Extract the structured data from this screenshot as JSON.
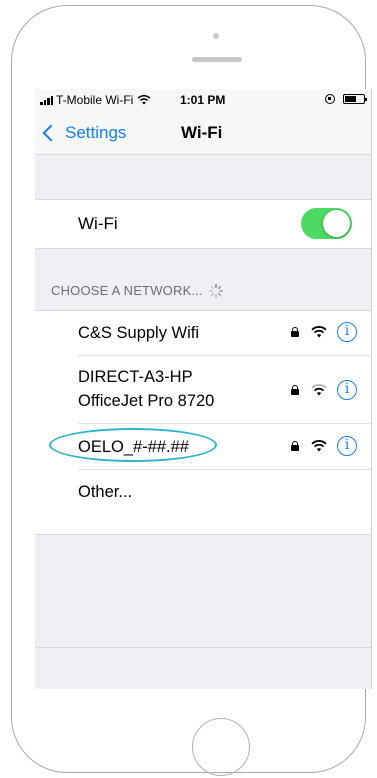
{
  "status_bar": {
    "carrier": "T-Mobile Wi-Fi",
    "time": "1:01 PM"
  },
  "nav": {
    "back_label": "Settings",
    "title": "Wi-Fi"
  },
  "wifi_toggle": {
    "label": "Wi-Fi",
    "on": true
  },
  "section_header": "CHOOSE A NETWORK...",
  "networks": [
    {
      "name": "C&S Supply Wifi",
      "secured": true,
      "info_glyph": "i"
    },
    {
      "name_line1": "DIRECT-A3-HP",
      "name_line2": "OfficeJet Pro 8720",
      "secured": true,
      "info_glyph": "i"
    },
    {
      "name": "OELO_#-##.##",
      "secured": true,
      "info_glyph": "i",
      "highlighted": true
    }
  ],
  "other_label": "Other...",
  "colors": {
    "accent": "#157efb",
    "toggle_on": "#4cd964",
    "highlight_ring": "#2fb3cc",
    "group_bg": "#efeff4"
  },
  "icons": [
    "signal-bars-icon",
    "wifi-icon",
    "rotation-lock-icon",
    "battery-icon",
    "chevron-left-icon",
    "padlock-icon",
    "info-icon",
    "spinner-icon"
  ]
}
